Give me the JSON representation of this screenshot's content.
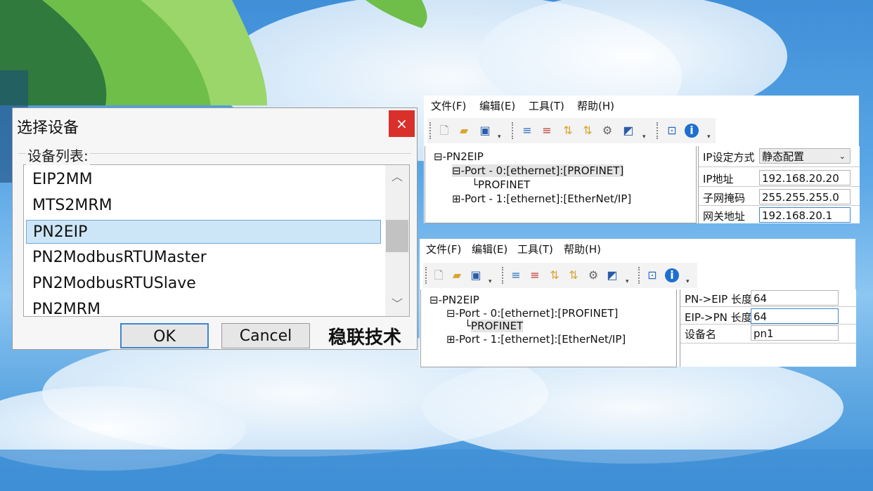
{
  "dialog": {
    "title": "选择设备",
    "close_label": "×",
    "group_label": "设备列表:",
    "items": [
      "EIP2MM",
      "MTS2MRM",
      "PN2EIP",
      "PN2ModbusRTUMaster",
      "PN2ModbusRTUSlave",
      "PN2MRM"
    ],
    "selected_index": 2,
    "ok_label": "OK",
    "cancel_label": "Cancel",
    "brand": "稳联技术"
  },
  "window_top": {
    "menu": [
      "文件(F)",
      "编辑(E)",
      "工具(T)",
      "帮助(H)"
    ],
    "tree": {
      "root": "PN2EIP",
      "port0": "Port - 0:[ethernet]:[PROFINET]",
      "port0_child": "PROFINET",
      "port1": "Port - 1:[ethernet]:[EtherNet/IP]"
    },
    "props": {
      "ip_mode_label": "IP设定方式",
      "ip_mode_value": "静态配置",
      "ip_label": "IP地址",
      "ip_value": "192.168.20.20",
      "mask_label": "子网掩码",
      "mask_value": "255.255.255.0",
      "gateway_label": "网关地址",
      "gateway_value": "192.168.20.1"
    }
  },
  "window_bottom": {
    "menu": [
      "文件(F)",
      "编辑(E)",
      "工具(T)",
      "帮助(H)"
    ],
    "tree": {
      "root": "PN2EIP",
      "port0": "Port - 0:[ethernet]:[PROFINET]",
      "port0_child": "PROFINET",
      "port1": "Port - 1:[ethernet]:[EtherNet/IP]"
    },
    "props": {
      "pn_eip_label": "PN->EIP 长度",
      "pn_eip_value": "64",
      "eip_pn_label": "EIP->PN 长度",
      "eip_pn_value": "64",
      "device_name_label": "设备名",
      "device_name_value": "pn1"
    }
  },
  "icons": [
    "new-file-icon",
    "open-folder-icon",
    "save-icon",
    "add-module-icon",
    "remove-module-icon",
    "upload-icon",
    "download-icon",
    "settings-icon",
    "edit-icon",
    "help-icon",
    "info-icon"
  ],
  "colors": {
    "close_red": "#d9302b",
    "selection": "#cde6f7",
    "accent": "#3d86d1"
  }
}
